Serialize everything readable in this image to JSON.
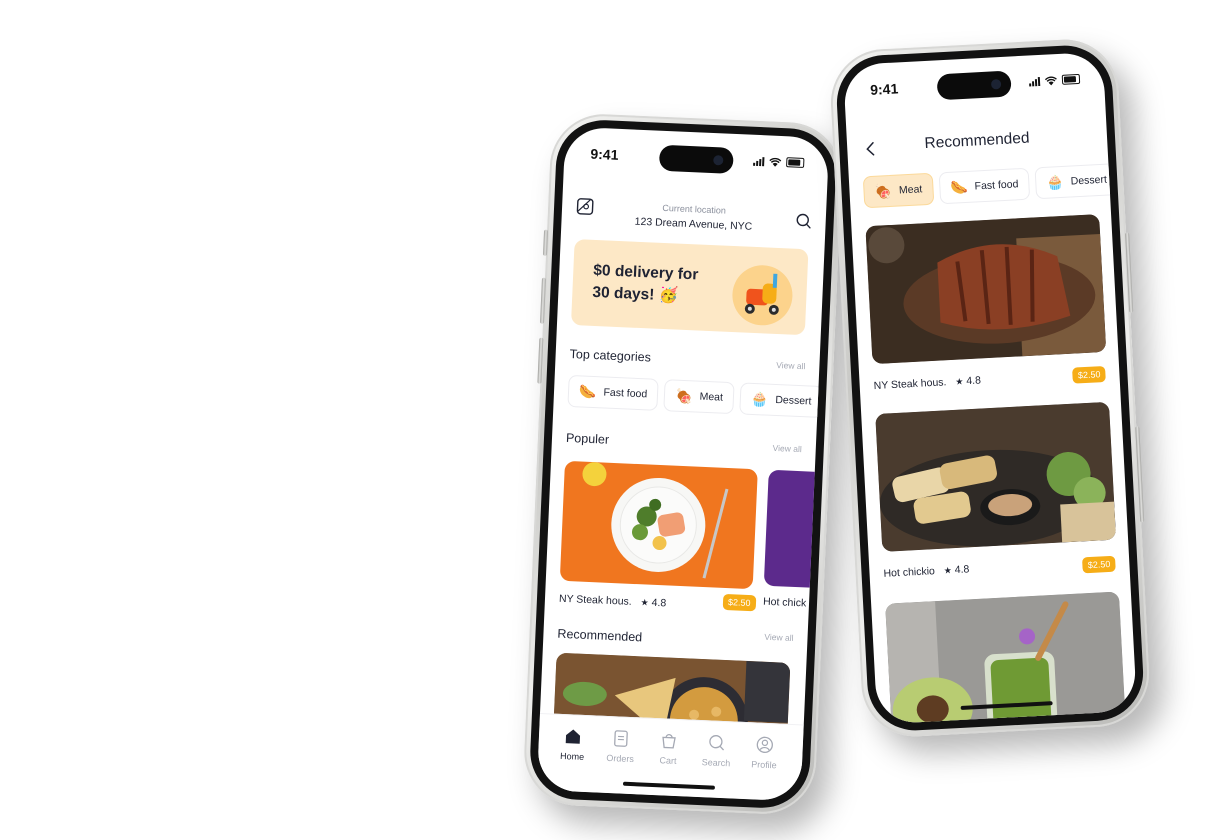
{
  "status": {
    "time": "9:41"
  },
  "home": {
    "location": {
      "caption": "Current location",
      "address": "123 Dream Avenue, NYC"
    },
    "banner": {
      "text": "$0 delivery for\n30 days! 🥳"
    },
    "top_categories": {
      "title": "Top categories",
      "view_all": "View all",
      "items": [
        {
          "emoji": "🌭",
          "label": "Fast food"
        },
        {
          "emoji": "🍖",
          "label": "Meat"
        },
        {
          "emoji": "🧁",
          "label": "Dessert"
        }
      ]
    },
    "popular": {
      "title": "Populer",
      "view_all": "View all",
      "items": [
        {
          "name": "NY Steak hous.",
          "rating": "4.8",
          "price": "$2.50"
        },
        {
          "name": "Hot chick"
        }
      ]
    },
    "recommended": {
      "title": "Recommended",
      "view_all": "View all"
    },
    "tabs": [
      {
        "label": "Home",
        "icon": "home-icon",
        "active": true
      },
      {
        "label": "Orders",
        "icon": "orders-icon"
      },
      {
        "label": "Cart",
        "icon": "cart-icon"
      },
      {
        "label": "Search",
        "icon": "search-icon"
      },
      {
        "label": "Profile",
        "icon": "profile-icon"
      }
    ]
  },
  "recommended_screen": {
    "title": "Recommended",
    "filters": [
      {
        "emoji": "🍖",
        "label": "Meat",
        "active": true
      },
      {
        "emoji": "🌭",
        "label": "Fast food"
      },
      {
        "emoji": "🧁",
        "label": "Dessert"
      }
    ],
    "items": [
      {
        "name": "NY Steak hous.",
        "rating": "4.8",
        "price": "$2.50"
      },
      {
        "name": "Hot chickio",
        "rating": "4.8",
        "price": "$2.50"
      }
    ]
  },
  "colors": {
    "accent": "#f6ad17",
    "banner": "#fde8c6",
    "text": "#1f2333"
  }
}
